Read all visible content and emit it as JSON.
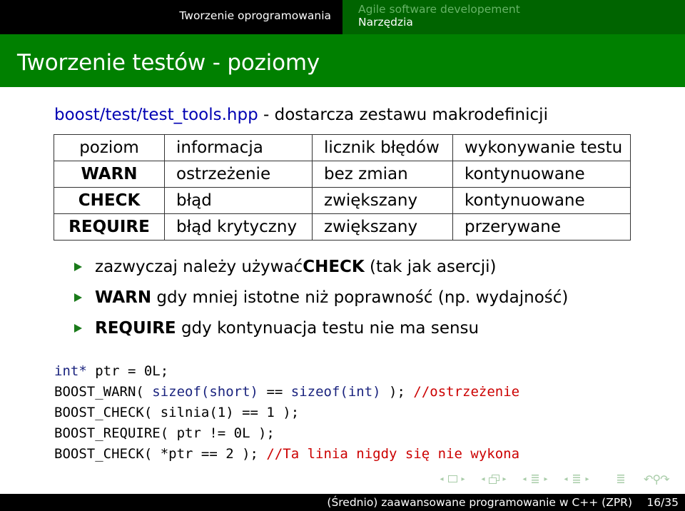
{
  "headline": {
    "section": "Tworzenie oprogramowania",
    "right_section": "Agile software developement",
    "subsection": "Narzędzia"
  },
  "frame": {
    "title": "Tworzenie testów - poziomy"
  },
  "intro": {
    "path": "boost/test/test_tools.hpp",
    "text": " - dostarcza zestawu makrodefinicji"
  },
  "table": {
    "header": [
      "poziom",
      "informacja",
      "licznik błędów",
      "wykonywanie testu"
    ],
    "rows": [
      [
        "WARN",
        "ostrzeżenie",
        "bez zmian",
        "kontynuowane"
      ],
      [
        "CHECK",
        "błąd",
        "zwiększany",
        "kontynuowane"
      ],
      [
        "REQUIRE",
        "błąd krytyczny",
        "zwiększany",
        "przerywane"
      ]
    ]
  },
  "bullets": [
    {
      "pre": "zazwyczaj należy używać ",
      "kw": "CHECK",
      "post": " (tak jak asercji)"
    },
    {
      "pre": "",
      "kw": "WARN",
      "post": " gdy mniej istotne niż poprawność (np. wydajność)"
    },
    {
      "pre": "",
      "kw": "REQUIRE",
      "post": " gdy kontynuacja testu nie ma sensu"
    }
  ],
  "code": {
    "l1_type": "int*",
    "l1_rest": " ptr = 0L;",
    "l2_a": "BOOST_WARN( ",
    "l2_b": "sizeof(short)",
    "l2_c": " == ",
    "l2_d": "sizeof(int)",
    "l2_e": " ); ",
    "l2_comment": "//ostrzeżenie",
    "l3": "BOOST_CHECK( silnia(1) == 1 );",
    "l4": "BOOST_REQUIRE( ptr != 0L );",
    "l5_a": "BOOST_CHECK( *ptr == 2 ); ",
    "l5_comment": "//Ta linia nigdy się nie wykona"
  },
  "nav": {
    "prev": "◂",
    "next": "▸",
    "search_symbols": "↶⚲↷"
  },
  "footer": {
    "title": "(Średnio) zaawansowane programowanie w C++ (ZPR)",
    "page": "16/35"
  },
  "colors": {
    "frame_green": "#008000",
    "header_dark_green": "#006400",
    "path_blue": "#0000b3",
    "comment_red": "#cc0000",
    "bullet_green": "#1a7a1a"
  }
}
